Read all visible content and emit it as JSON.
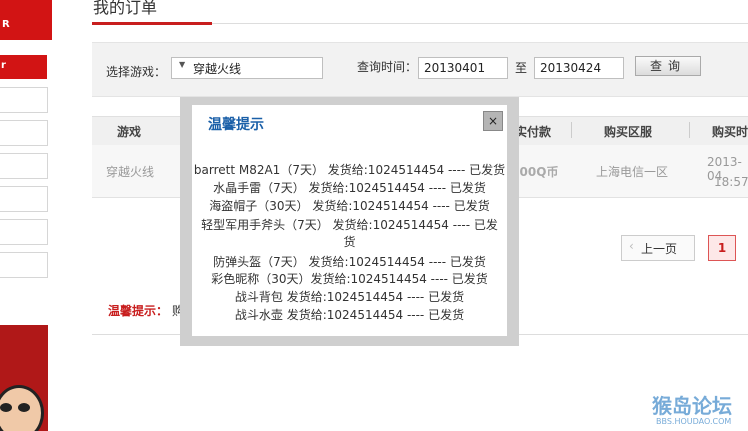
{
  "sidebar": {
    "top_text": "R",
    "item_text": "r"
  },
  "page": {
    "title": "我的订单"
  },
  "search": {
    "game_label": "选择游戏：",
    "game_value": "穿越火线",
    "time_label": "查询时间：",
    "date_from": "20130401",
    "to_label": "至",
    "date_to": "20130424",
    "query_label": "查询"
  },
  "table": {
    "headers": [
      "游戏",
      "实付款",
      "购买区服",
      "购买时"
    ],
    "row": {
      "game": "穿越火线",
      "paid": ".00Q币",
      "server": "上海电信一区",
      "date": "2013-04",
      "time": "18:57:"
    }
  },
  "pagination": {
    "prev_label": "上一页",
    "page_label": "1"
  },
  "tip": {
    "label": "温馨提示：",
    "text": "购"
  },
  "watermark": {
    "main": "猴岛论坛",
    "sub": "BBS.HOUDAO.COM"
  },
  "modal": {
    "title": "温馨提示",
    "close": "×",
    "lines": [
      "barrett M82A1（7天） 发货给:1024514454 ---- 已发货",
      "水晶手雷（7天） 发货给:1024514454 ---- 已发货",
      "海盗帽子（30天） 发货给:1024514454 ---- 已发货",
      "轻型军用手斧头（7天） 发货给:1024514454 ---- 已发",
      "货",
      "防弹头盔（7天） 发货给:1024514454 ---- 已发货",
      "彩色昵称（30天）发货给:1024514454 ---- 已发货",
      "战斗背包 发货给:1024514454 ---- 已发货",
      "战斗水壶 发货给:1024514454 ---- 已发货"
    ]
  }
}
